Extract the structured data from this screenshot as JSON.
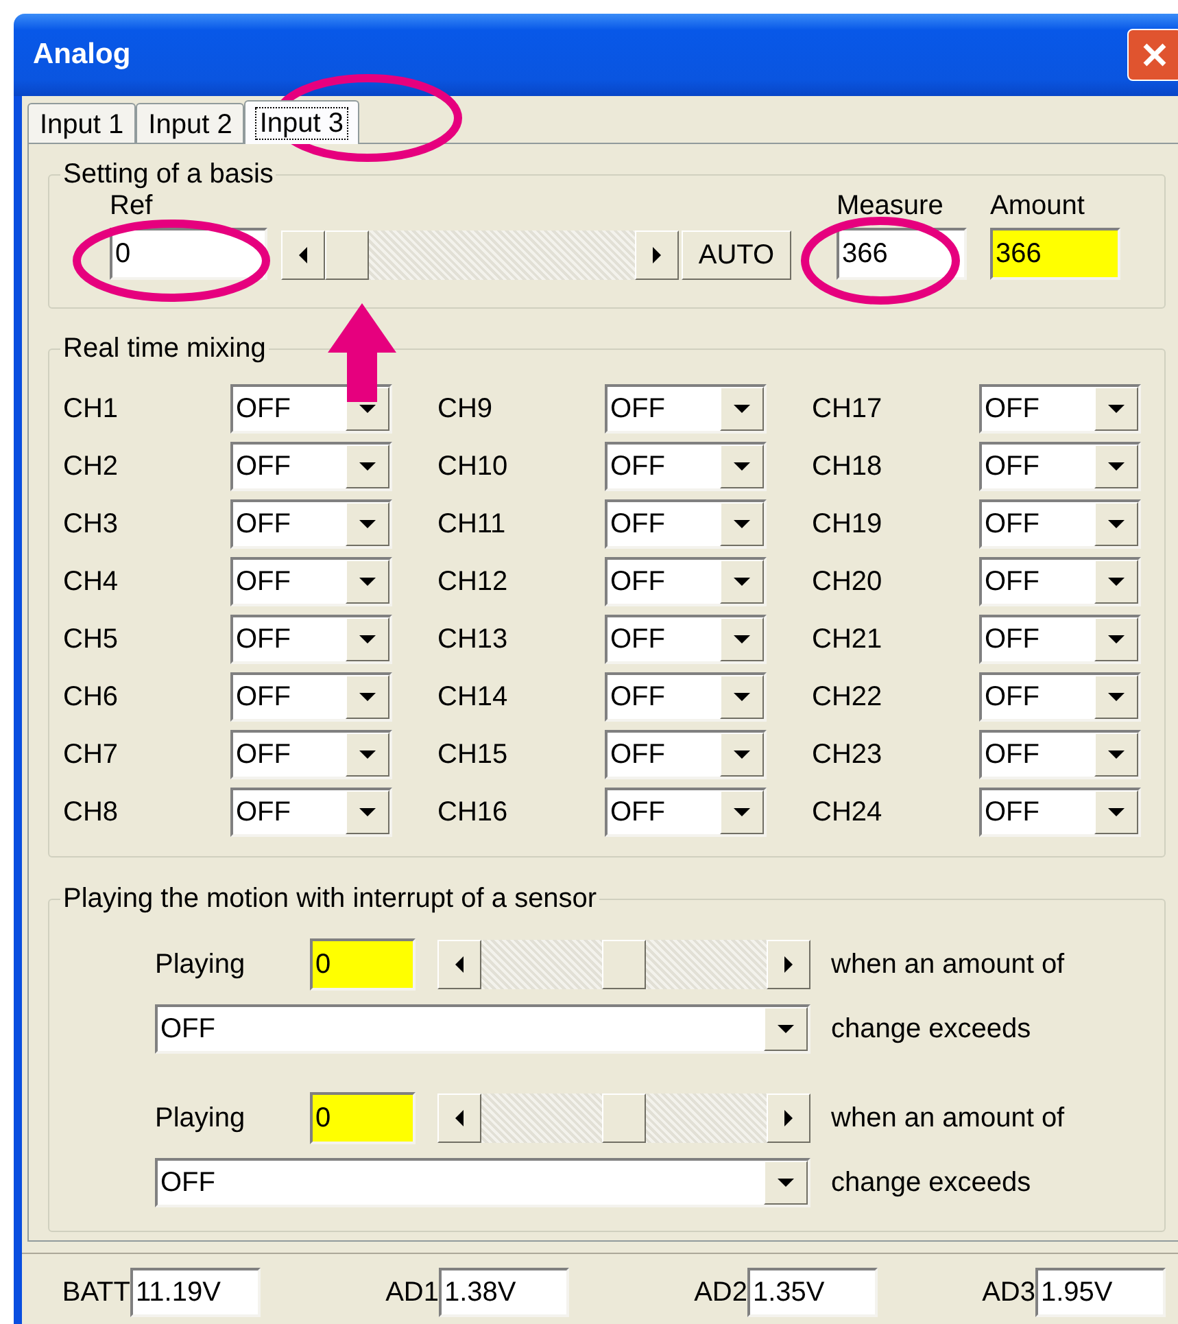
{
  "window": {
    "title": "Analog"
  },
  "tabs": [
    {
      "label": "Input 1",
      "selected": false
    },
    {
      "label": "Input 2",
      "selected": false
    },
    {
      "label": "Input 3",
      "selected": true
    }
  ],
  "basis": {
    "title": "Setting of a basis",
    "ref": {
      "label": "Ref",
      "value": "0",
      "highlighted": false
    },
    "slider": {
      "level": 0
    },
    "auto_button": "AUTO",
    "measure": {
      "label": "Measure",
      "value": "366",
      "highlighted": false
    },
    "amount": {
      "label": "Amount",
      "value": "366",
      "highlighted": true
    }
  },
  "mixing": {
    "title": "Real time mixing",
    "channels": [
      {
        "label": "CH1",
        "value": "OFF"
      },
      {
        "label": "CH2",
        "value": "OFF"
      },
      {
        "label": "CH3",
        "value": "OFF"
      },
      {
        "label": "CH4",
        "value": "OFF"
      },
      {
        "label": "CH5",
        "value": "OFF"
      },
      {
        "label": "CH6",
        "value": "OFF"
      },
      {
        "label": "CH7",
        "value": "OFF"
      },
      {
        "label": "CH8",
        "value": "OFF"
      },
      {
        "label": "CH9",
        "value": "OFF"
      },
      {
        "label": "CH10",
        "value": "OFF"
      },
      {
        "label": "CH11",
        "value": "OFF"
      },
      {
        "label": "CH12",
        "value": "OFF"
      },
      {
        "label": "CH13",
        "value": "OFF"
      },
      {
        "label": "CH14",
        "value": "OFF"
      },
      {
        "label": "CH15",
        "value": "OFF"
      },
      {
        "label": "CH16",
        "value": "OFF"
      },
      {
        "label": "CH17",
        "value": "OFF"
      },
      {
        "label": "CH18",
        "value": "OFF"
      },
      {
        "label": "CH19",
        "value": "OFF"
      },
      {
        "label": "CH20",
        "value": "OFF"
      },
      {
        "label": "CH21",
        "value": "OFF"
      },
      {
        "label": "CH22",
        "value": "OFF"
      },
      {
        "label": "CH23",
        "value": "OFF"
      },
      {
        "label": "CH24",
        "value": "OFF"
      }
    ]
  },
  "sensor": {
    "title": "Playing the motion with interrupt of a sensor",
    "rules": [
      {
        "label": "Playing",
        "value": "0",
        "highlighted": true,
        "level": 0.5,
        "text_1": "when an amount of",
        "option": "OFF",
        "text_2": "change exceeds"
      },
      {
        "label": "Playing",
        "value": "0",
        "highlighted": true,
        "level": 0.5,
        "text_1": "when an amount of",
        "option": "OFF",
        "text_2": "change exceeds"
      }
    ]
  },
  "status_bar": [
    {
      "label": "BATT",
      "value": "11.19V"
    },
    {
      "label": "AD1",
      "value": "1.38V"
    },
    {
      "label": "AD2",
      "value": "1.35V"
    },
    {
      "label": "AD3",
      "value": "1.95V"
    }
  ]
}
